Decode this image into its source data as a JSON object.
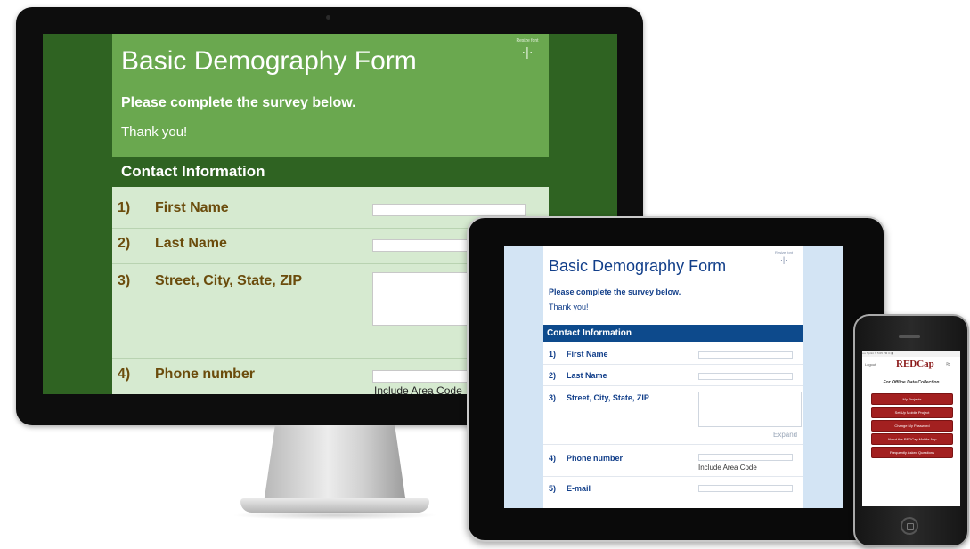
{
  "desktop": {
    "form_title": "Basic Demography Form",
    "instructions": "Please complete the survey below.",
    "thanks": "Thank you!",
    "resize_label": "Resize font",
    "resize_icon": "·|·",
    "section_title": "Contact Information",
    "fields": [
      {
        "num": "1)",
        "label": "First Name"
      },
      {
        "num": "2)",
        "label": "Last Name"
      },
      {
        "num": "3)",
        "label": "Street, City, State, ZIP"
      },
      {
        "num": "4)",
        "label": "Phone number"
      }
    ],
    "phone_note": "Include Area Code"
  },
  "tablet": {
    "form_title": "Basic Demography Form",
    "instructions": "Please complete the survey below.",
    "thanks": "Thank you!",
    "resize_label": "Resize font",
    "resize_icon": "·|·",
    "section_title": "Contact Information",
    "fields": [
      {
        "num": "1)",
        "label": "First Name"
      },
      {
        "num": "2)",
        "label": "Last Name"
      },
      {
        "num": "3)",
        "label": "Street, City, State, ZIP"
      },
      {
        "num": "4)",
        "label": "Phone number"
      },
      {
        "num": "5)",
        "label": "E-mail"
      }
    ],
    "expand_link": "Expand",
    "phone_note": "Include Area Code"
  },
  "phone": {
    "status_bar": "•••• Sprint  ✈  5:05 PM  ⊙ ▮",
    "logout": "Logout",
    "logo": "REDCap",
    "wifi_icon": "wifi-icon",
    "tagline": "For Offline Data Collection",
    "menu": [
      "My Projects",
      "Set Up Mobile Project",
      "Change My Password",
      "About the REDCap Mobile App",
      "Frequently Asked Questions"
    ]
  },
  "colors": {
    "desktop_header": "#6aa84f",
    "desktop_section": "#2f6322",
    "desktop_body": "#d6ead0",
    "desktop_text": "#6b4c0c",
    "tablet_title": "#123f8a",
    "tablet_section": "#0d4a8c",
    "phone_button": "#a32020"
  }
}
